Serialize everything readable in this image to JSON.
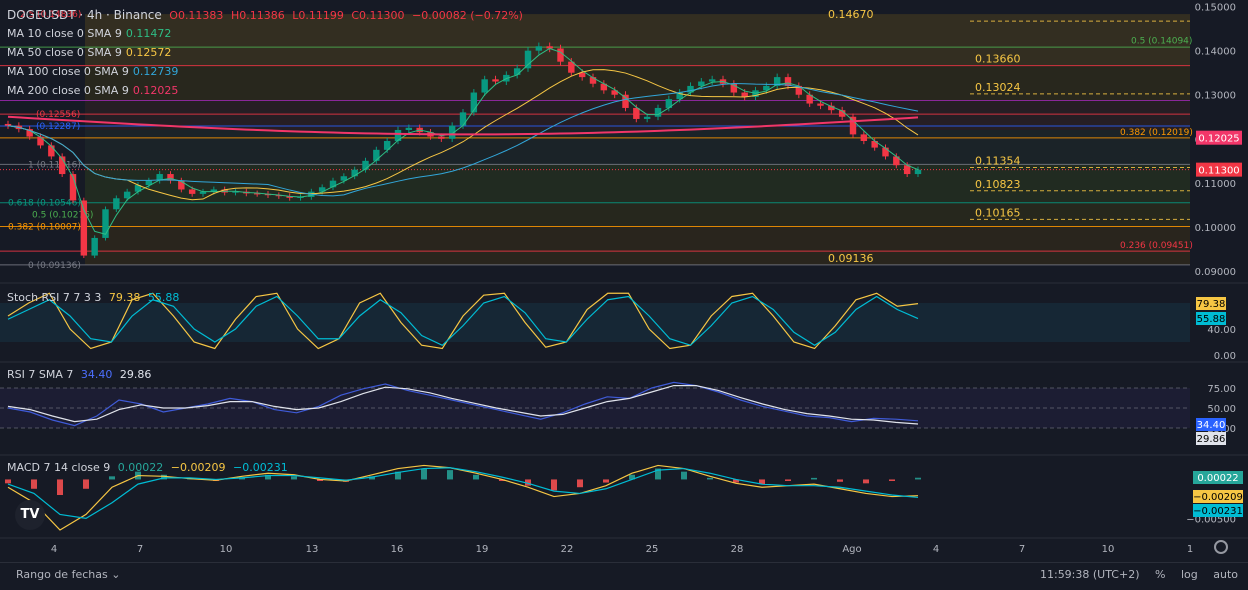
{
  "header": {
    "symbol": "DOGEUSDT · 4h · Binance",
    "open": "O0.11383",
    "high": "H0.11386",
    "low": "L0.11199",
    "close": "C0.11300",
    "change": "−0.00082 (−0.72%)"
  },
  "ma_legend": [
    {
      "label": "MA 10 close 0 SMA 9",
      "value": "0.11472",
      "color": "#2ebd85"
    },
    {
      "label": "MA 50 close 0 SMA 9",
      "value": "0.12572",
      "color": "#f6c644"
    },
    {
      "label": "MA 100 close 0 SMA 9",
      "value": "0.12739",
      "color": "#32a6d9"
    },
    {
      "label": "MA 200 close 0 SMA 9",
      "value": "0.12025",
      "color": "#f23669"
    }
  ],
  "price_axis": [
    "0.15000",
    "0.14000",
    "0.13000",
    "0.12000",
    "0.11000",
    "0.10000",
    "0.09000"
  ],
  "price_badges": [
    {
      "value": "0.12025",
      "color": "#f23669"
    },
    {
      "value": "0.11300",
      "color": "#f23645"
    }
  ],
  "fib_left": [
    {
      "label": "2.5 (0.14836)",
      "color": "#f23645"
    },
    {
      "label": "(0.12556)",
      "color": "#f23645"
    },
    {
      "label": "(0.12287)",
      "color": "#2962ff"
    },
    {
      "label": "1 (0.11416)",
      "color": "#787b86"
    },
    {
      "label": "0.618 (0.10546)",
      "color": "#089981"
    },
    {
      "label": "0.5 (0.10276)",
      "color": "#4caf50"
    },
    {
      "label": "0.382 (0.10007)",
      "color": "#ff9800"
    },
    {
      "label": "0 (0.09136)",
      "color": "#787b86"
    }
  ],
  "fib_right": [
    {
      "label": "0.5 (0.14094)",
      "color": "#4caf50"
    },
    {
      "label": "0.382 (0.12019)",
      "color": "#ff9800"
    },
    {
      "label": "0.236 (0.09451)",
      "color": "#f23645"
    }
  ],
  "level_labels": [
    "0.14670",
    "0.13660",
    "0.13024",
    "0.11354",
    "0.10823",
    "0.10165",
    "0.09136"
  ],
  "stoch": {
    "title": "Stoch RSI 7 7 3 3",
    "k": "79.38",
    "d": "55.88",
    "axis": [
      "40.00",
      "0.00"
    ]
  },
  "rsi": {
    "title": "RSI 7 SMA 7",
    "rsi": "34.40",
    "sma": "29.86",
    "axis": [
      "75.00",
      "50.00",
      "25.00"
    ]
  },
  "macd": {
    "title": "MACD 7 14 close 9",
    "hist": "0.00022",
    "macd": "−0.00209",
    "signal": "−0.00231",
    "axis": [
      "−0.00500"
    ]
  },
  "time_axis": [
    "4",
    "7",
    "10",
    "13",
    "16",
    "19",
    "22",
    "25",
    "28",
    "Ago",
    "4",
    "7",
    "10",
    "1"
  ],
  "bottom": {
    "date_range": "Rango de fechas",
    "clock": "11:59:38 (UTC+2)",
    "percent": "%",
    "log": "log",
    "auto": "auto"
  },
  "chart_data": [
    {
      "type": "candlestick",
      "title": "DOGEUSDT · 4h · Binance",
      "ylim": [
        0.0875,
        0.1515
      ],
      "close_series": [
        0.123,
        0.1222,
        0.1205,
        0.1185,
        0.116,
        0.112,
        0.106,
        0.0935,
        0.0975,
        0.104,
        0.1065,
        0.108,
        0.1095,
        0.1105,
        0.112,
        0.1105,
        0.1085,
        0.1075,
        0.108,
        0.1085,
        0.1078,
        0.108,
        0.1076,
        0.1075,
        0.1072,
        0.107,
        0.1066,
        0.1068,
        0.108,
        0.109,
        0.1105,
        0.1115,
        0.113,
        0.115,
        0.1175,
        0.1195,
        0.122,
        0.1225,
        0.1215,
        0.1205,
        0.12,
        0.123,
        0.126,
        0.1305,
        0.1335,
        0.133,
        0.1345,
        0.136,
        0.14,
        0.141,
        0.1405,
        0.1375,
        0.135,
        0.134,
        0.1325,
        0.131,
        0.13,
        0.127,
        0.1245,
        0.125,
        0.127,
        0.129,
        0.1305,
        0.132,
        0.133,
        0.1335,
        0.1325,
        0.1305,
        0.1295,
        0.131,
        0.132,
        0.134,
        0.132,
        0.13,
        0.128,
        0.1275,
        0.1265,
        0.125,
        0.121,
        0.1195,
        0.118,
        0.116,
        0.114,
        0.112,
        0.113
      ],
      "ma_series": [
        "MA 10",
        "MA 50",
        "MA 100",
        "MA 200"
      ]
    },
    {
      "type": "line",
      "title": "Stoch RSI 7 7 3 3",
      "series": [
        {
          "name": "K",
          "values": [
            60,
            80,
            95,
            40,
            10,
            20,
            85,
            95,
            60,
            20,
            10,
            55,
            90,
            95,
            40,
            10,
            25,
            80,
            95,
            50,
            15,
            10,
            60,
            92,
            95,
            50,
            12,
            20,
            70,
            95,
            95,
            40,
            10,
            15,
            60,
            90,
            95,
            60,
            20,
            10,
            45,
            85,
            95,
            75,
            79
          ]
        },
        {
          "name": "D",
          "values": [
            55,
            70,
            85,
            60,
            25,
            20,
            60,
            85,
            75,
            40,
            20,
            40,
            75,
            90,
            60,
            25,
            25,
            60,
            85,
            65,
            30,
            15,
            45,
            80,
            90,
            65,
            25,
            20,
            55,
            85,
            90,
            60,
            25,
            15,
            45,
            80,
            90,
            70,
            35,
            15,
            35,
            70,
            90,
            70,
            56
          ]
        }
      ],
      "ylim": [
        0,
        100
      ]
    },
    {
      "type": "line",
      "title": "RSI 7 SMA 7",
      "series": [
        {
          "name": "RSI",
          "values": [
            50,
            45,
            35,
            28,
            40,
            60,
            55,
            45,
            50,
            55,
            62,
            58,
            48,
            44,
            52,
            66,
            74,
            80,
            72,
            66,
            60,
            54,
            48,
            42,
            36,
            44,
            55,
            64,
            62,
            75,
            82,
            78,
            70,
            60,
            52,
            46,
            40,
            38,
            33,
            37,
            36,
            34
          ]
        },
        {
          "name": "SMA",
          "values": [
            52,
            48,
            40,
            33,
            36,
            48,
            54,
            50,
            50,
            53,
            58,
            58,
            52,
            48,
            50,
            58,
            68,
            76,
            74,
            69,
            62,
            56,
            50,
            45,
            40,
            42,
            50,
            58,
            62,
            70,
            78,
            78,
            72,
            63,
            55,
            48,
            43,
            40,
            36,
            35,
            32,
            30
          ]
        }
      ],
      "ylim": [
        0,
        100
      ]
    },
    {
      "type": "bar",
      "title": "MACD 7 14 close 9",
      "series": [
        {
          "name": "Histogram",
          "values": [
            -0.0005,
            -0.0012,
            -0.002,
            -0.0012,
            0.0004,
            0.001,
            0.0006,
            0.0002,
            -0.0002,
            0.0003,
            0.0006,
            0.0004,
            -0.0002,
            -0.0003,
            0.0004,
            0.001,
            0.0014,
            0.0012,
            0.0006,
            -0.0002,
            -0.0008,
            -0.0014,
            -0.001,
            -0.0004,
            0.0006,
            0.0014,
            0.001,
            0.0002,
            -0.0004,
            -0.0006,
            -0.0002,
            0.0002,
            -0.0003,
            -0.0005,
            -0.0002,
            0.00022
          ]
        },
        {
          "name": "MACD",
          "values": [
            -0.001,
            -0.003,
            -0.0065,
            -0.0045,
            -0.001,
            0.0005,
            0.0004,
            0.0001,
            -0.0001,
            0.0004,
            0.0008,
            0.0006,
            0.0,
            -0.0002,
            0.0006,
            0.0014,
            0.0018,
            0.0015,
            0.0008,
            0.0,
            -0.001,
            -0.0022,
            -0.0018,
            -0.0008,
            0.0008,
            0.0018,
            0.0014,
            0.0004,
            -0.0005,
            -0.001,
            -0.0008,
            -0.0006,
            -0.0012,
            -0.0018,
            -0.0022,
            -0.00209
          ]
        },
        {
          "name": "Signal",
          "values": [
            -0.0006,
            -0.0018,
            -0.0045,
            -0.005,
            -0.003,
            -0.0006,
            0.0002,
            0.0002,
            0.0,
            0.0002,
            0.0005,
            0.0005,
            0.0002,
            -0.0001,
            0.0003,
            0.0009,
            0.0014,
            0.0015,
            0.001,
            0.0003,
            -0.0005,
            -0.0015,
            -0.0018,
            -0.0012,
            0.0,
            0.0012,
            0.0014,
            0.0008,
            0.0,
            -0.0006,
            -0.0008,
            -0.0008,
            -0.001,
            -0.0015,
            -0.002,
            -0.00231
          ]
        }
      ],
      "ylim": [
        -0.0065,
        0.0025
      ]
    }
  ],
  "colors": {
    "up": "#089981",
    "down": "#f23645",
    "background": "#161a25",
    "grid": "#2a2e39"
  }
}
